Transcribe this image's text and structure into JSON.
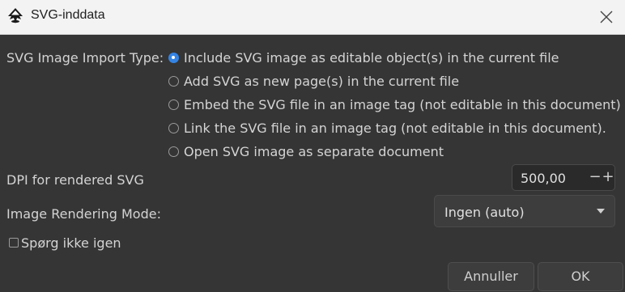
{
  "window": {
    "title": "SVG-inddata",
    "app_icon": "inkscape-icon",
    "close_icon": "close-icon"
  },
  "import_type": {
    "label": "SVG Image Import Type:",
    "options": [
      {
        "label": "Include SVG image as editable object(s) in the current file",
        "checked": true
      },
      {
        "label": "Add SVG as new page(s) in the current file",
        "checked": false
      },
      {
        "label": "Embed the SVG file in an image tag (not editable in this document)",
        "checked": false
      },
      {
        "label": "Link the SVG file in an image tag (not editable in this document).",
        "checked": false
      },
      {
        "label": "Open SVG image as separate document",
        "checked": false
      }
    ]
  },
  "dpi": {
    "label": "DPI for rendered SVG",
    "value": "500,00",
    "minus": "−",
    "plus": "+"
  },
  "rendering_mode": {
    "label": "Image Rendering Mode:",
    "value": "Ingen (auto)"
  },
  "dont_ask": {
    "label": "Spørg ikke igen",
    "checked": false
  },
  "buttons": {
    "cancel": "Annuller",
    "ok": "OK"
  },
  "colors": {
    "accent": "#3584e4",
    "background": "#353535",
    "titlebar": "#f3f3f3"
  }
}
